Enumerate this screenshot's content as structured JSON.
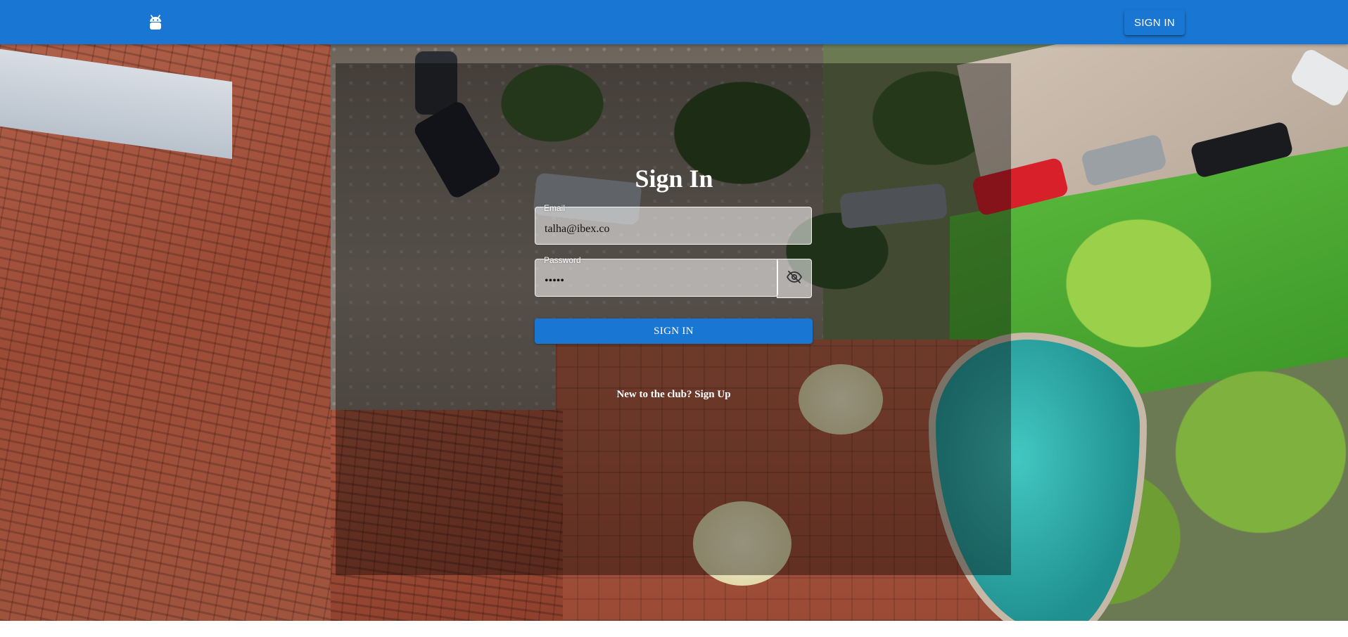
{
  "header": {
    "logo_icon": "android-icon",
    "signin_label": "SIGN IN",
    "bar_color": "#1976d2"
  },
  "background": {
    "image": "aerial-view-villa-pool-cars"
  },
  "form": {
    "title": "Sign In",
    "email": {
      "label": "Email",
      "value": "talha@ibex.co"
    },
    "password": {
      "label": "Password",
      "value": "•••••",
      "toggle_icon": "eye-off-icon"
    },
    "submit_label": "SIGN IN",
    "signup_text": "New to the club? Sign Up"
  }
}
